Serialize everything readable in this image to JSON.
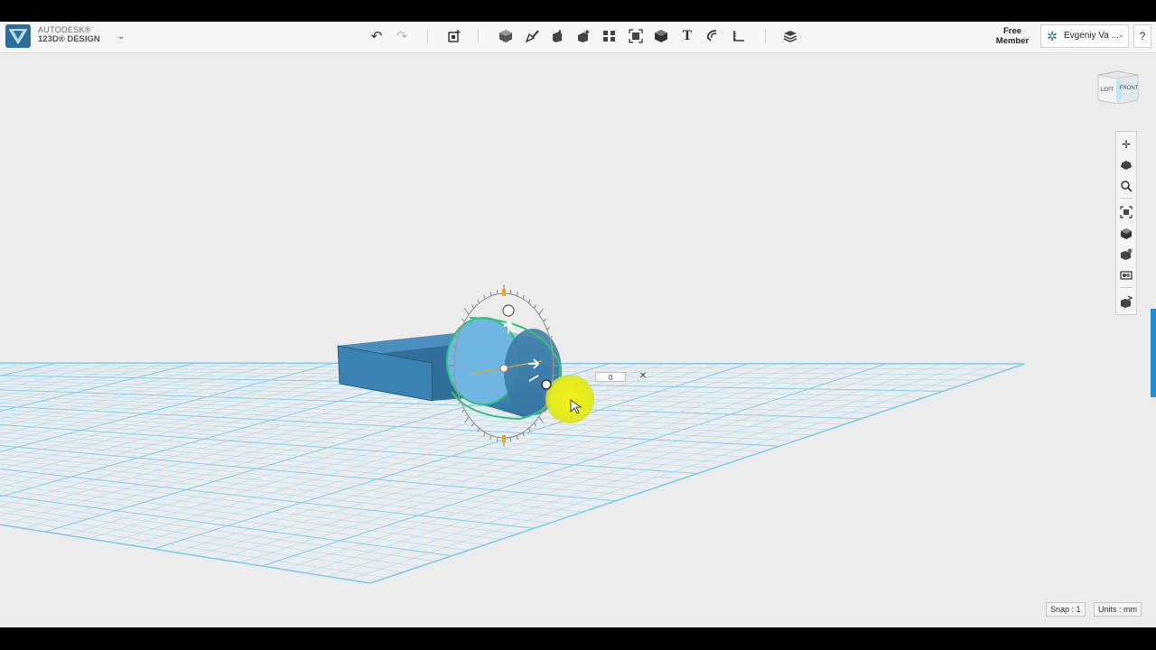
{
  "app": {
    "brand_line1": "AUTODESK®",
    "brand_line2": "123D® DESIGN",
    "menu_caret": "⌄"
  },
  "toolbar": {
    "undo_icon": "↶",
    "redo_icon": "↷",
    "tools": [
      "primitives-icon",
      "sketch-icon",
      "construct-icon",
      "modify-icon",
      "pattern-icon",
      "grouping-icon",
      "combine-icon",
      "text-icon",
      "snap-icon",
      "measure-icon"
    ],
    "material_icon": "material-icon"
  },
  "account": {
    "member_line1": "Free",
    "member_line2": "Member",
    "user_name": "Evgeniy Va ...",
    "caret": "⌄",
    "help": "?"
  },
  "viewcube": {
    "left_face": "LEFT",
    "front_face": "FRONT"
  },
  "navbar": {
    "items": [
      "pan-icon",
      "orbit-icon",
      "zoom-icon",
      "fit-icon",
      "perspective-icon",
      "visibility-icon",
      "materials-outlines-icon",
      "grid-icon"
    ]
  },
  "gizmo": {
    "value": "0"
  },
  "status": {
    "snap": "Snap : 1",
    "units": "Units : mm"
  },
  "colors": {
    "grid": "#7fcbe8",
    "box": "#2f7aa8",
    "cylinder": "#4d9ccc",
    "highlight": "#e6ec1a",
    "accent": "#1d8fd6"
  }
}
